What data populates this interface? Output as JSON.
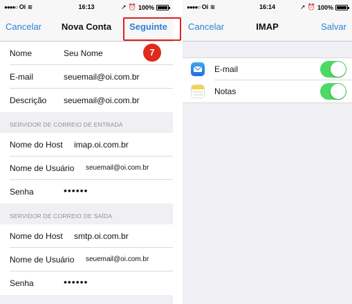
{
  "left": {
    "status": {
      "carrier": "Oi",
      "time": "16:13",
      "battery": "100%"
    },
    "nav": {
      "cancel": "Cancelar",
      "title": "Nova Conta",
      "next": "Seguinte"
    },
    "step_badge": "7",
    "account": [
      {
        "label": "Nome",
        "value": "Seu Nome"
      },
      {
        "label": "E-mail",
        "value": "seuemail@oi.com.br"
      },
      {
        "label": "Descrição",
        "value": "seuemail@oi.com.br"
      }
    ],
    "incoming": {
      "header": "SERVIDOR DE CORREIO DE ENTRADA",
      "host_label": "Nome do Host",
      "host_value": "imap.oi.com.br",
      "user_label": "Nome de Usuário",
      "user_value": "seuemail@oi.com.br",
      "password_label": "Senha",
      "password_value": "••••••"
    },
    "outgoing": {
      "header": "SERVIDOR DE CORREIO DE SAÍDA",
      "host_label": "Nome do Host",
      "host_value": "smtp.oi.com.br",
      "user_label": "Nome de Usuário",
      "user_value": "seuemail@oi.com.br",
      "password_label": "Senha",
      "password_value": "••••••"
    }
  },
  "right": {
    "status": {
      "carrier": "Oi",
      "time": "16:14",
      "battery": "100%"
    },
    "nav": {
      "cancel": "Cancelar",
      "title": "IMAP",
      "save": "Salvar"
    },
    "items": [
      {
        "label": "E-mail",
        "icon": "mail-app-icon",
        "enabled": true
      },
      {
        "label": "Notas",
        "icon": "notes-app-icon",
        "enabled": true
      }
    ]
  },
  "colors": {
    "accent": "#2f7fd1",
    "toggle_on": "#4cd964",
    "highlight": "#e02020"
  }
}
